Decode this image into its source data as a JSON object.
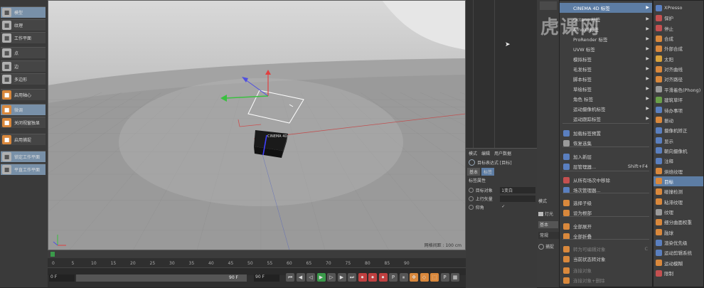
{
  "palette": {
    "items": [
      {
        "label": "模型",
        "icon": "cube-icon",
        "active": true
      },
      {
        "label": "纹理",
        "icon": "checker-icon",
        "active": false
      },
      {
        "label": "工作平面",
        "icon": "workplane-icon",
        "active": false
      },
      {
        "label": "点",
        "icon": "points-icon",
        "active": false
      },
      {
        "label": "边",
        "icon": "edges-icon",
        "active": false
      },
      {
        "label": "多边形",
        "icon": "polygon-icon",
        "active": false
      },
      {
        "label": "启用轴心",
        "icon": "axis-icon",
        "active": false
      },
      {
        "label": "微调",
        "icon": "tweak-icon",
        "active": true
      },
      {
        "label": "关闭视窗独显",
        "icon": "solo-icon",
        "active": false
      },
      {
        "label": "启用捕捉",
        "icon": "snap-icon",
        "active": false
      },
      {
        "label": "锁定工作平面",
        "icon": "lock-plane-icon",
        "active": true
      },
      {
        "label": "平直工作平面",
        "icon": "flat-plane-icon",
        "active": true
      }
    ]
  },
  "viewport": {
    "grid_label": "网格间距 : 100 cm",
    "object_label": "CINEMA 4D"
  },
  "timeline": {
    "ticks": [
      "0",
      "5",
      "10",
      "15",
      "20",
      "25",
      "30",
      "35",
      "40",
      "45",
      "50",
      "55",
      "60",
      "65",
      "70",
      "75",
      "80",
      "85",
      "90"
    ],
    "current_frame": "0 F",
    "start_frame": "0 F",
    "end_frame": "90 F",
    "end_frame2": "90 F",
    "frame_field": "0 F"
  },
  "attr": {
    "tabs": [
      "模式",
      "编辑",
      "用户数据"
    ],
    "title": "目标表达式 [目标]",
    "subtabs": [
      "基本",
      "标签"
    ],
    "section": "标签属性",
    "rows": [
      {
        "label": "目标对象",
        "value": "1变白"
      },
      {
        "label": "上行矢量",
        "value": ""
      },
      {
        "label": "仰角",
        "value": "✓"
      }
    ]
  },
  "right_panel": {
    "mode_tab": "模式",
    "lights_label": "灯光",
    "basic_tab": "基本",
    "coords_label": "常规",
    "snap_label": "捕捉"
  },
  "menu": {
    "items": [
      {
        "label": "CINEMA 4D 标签",
        "type": "submenu",
        "selected": true
      },
      {
        "label": "Octane 标签",
        "type": "submenu"
      },
      {
        "label": "Arnold 标签",
        "type": "submenu"
      },
      {
        "label": "ProRender 标签",
        "type": "submenu"
      },
      {
        "label": "UVW 标签",
        "type": "submenu"
      },
      {
        "label": "模拟标签",
        "type": "submenu"
      },
      {
        "label": "毛发标签",
        "type": "submenu"
      },
      {
        "label": "脚本标签",
        "type": "submenu"
      },
      {
        "label": "草绘标签",
        "type": "submenu"
      },
      {
        "label": "角色 标签",
        "type": "submenu"
      },
      {
        "label": "运动摄像机标签",
        "type": "submenu"
      },
      {
        "label": "运动跟踪标签",
        "type": "submenu"
      },
      {
        "label": "加载标签预置",
        "type": "item"
      },
      {
        "label": "恢复选集",
        "type": "item"
      },
      {
        "label": "加入新层",
        "type": "item"
      },
      {
        "label": "层管理器...",
        "type": "item",
        "shortcut": "Shift+F4"
      },
      {
        "label": "从所有场次中移除",
        "type": "item"
      },
      {
        "label": "场次管理器...",
        "type": "item"
      },
      {
        "label": "选择子级",
        "type": "item"
      },
      {
        "label": "设为根部",
        "type": "item"
      },
      {
        "label": "全部展开",
        "type": "item"
      },
      {
        "label": "全部折叠",
        "type": "item"
      },
      {
        "label": "转为可编辑对象",
        "type": "item",
        "dim": true,
        "shortcut": "C"
      },
      {
        "label": "当前状态转对象",
        "type": "item"
      },
      {
        "label": "连接对象",
        "type": "item",
        "dim": true
      },
      {
        "label": "连接对象+删除",
        "type": "item",
        "dim": true
      }
    ]
  },
  "submenu": {
    "items": [
      {
        "label": "XPresso",
        "color": "#5a7fbf"
      },
      {
        "label": "保护",
        "color": "#c45050"
      },
      {
        "label": "停止",
        "color": "#c45050"
      },
      {
        "label": "合成",
        "color": "#d9883c"
      },
      {
        "label": "外部合成",
        "color": "#d9883c"
      },
      {
        "label": "太阳",
        "color": "#d9a23c"
      },
      {
        "label": "对齐曲线",
        "color": "#d9883c"
      },
      {
        "label": "对齐路径",
        "color": "#d9883c"
      },
      {
        "label": "平滑着色(Phong)",
        "color": "#9a9a9a"
      },
      {
        "label": "建筑草坪",
        "color": "#6aa04a"
      },
      {
        "label": "待办事项",
        "color": "#5a7fbf"
      },
      {
        "label": "振动",
        "color": "#d9883c"
      },
      {
        "label": "摄像机矫正",
        "color": "#5a7fbf"
      },
      {
        "label": "显示",
        "color": "#5a7fbf"
      },
      {
        "label": "朝向摄像机",
        "color": "#5a7fbf"
      },
      {
        "label": "注释",
        "color": "#5a7fbf"
      },
      {
        "label": "烘焙纹理",
        "color": "#d9883c"
      },
      {
        "label": "目标",
        "color": "#d9883c",
        "selected": true
      },
      {
        "label": "碰撞检测",
        "color": "#d9883c"
      },
      {
        "label": "粘滞纹理",
        "color": "#d9883c"
      },
      {
        "label": "纹理",
        "color": "#9a9a9a"
      },
      {
        "label": "细分曲面权重",
        "color": "#d9883c"
      },
      {
        "label": "融球",
        "color": "#d9883c"
      },
      {
        "label": "渲染优先级",
        "color": "#5a7fbf"
      },
      {
        "label": "运动剪辑系统",
        "color": "#5a7fbf"
      },
      {
        "label": "运动模糊",
        "color": "#d9883c"
      },
      {
        "label": "限制",
        "color": "#c45050"
      }
    ]
  },
  "watermark": "虎课网"
}
